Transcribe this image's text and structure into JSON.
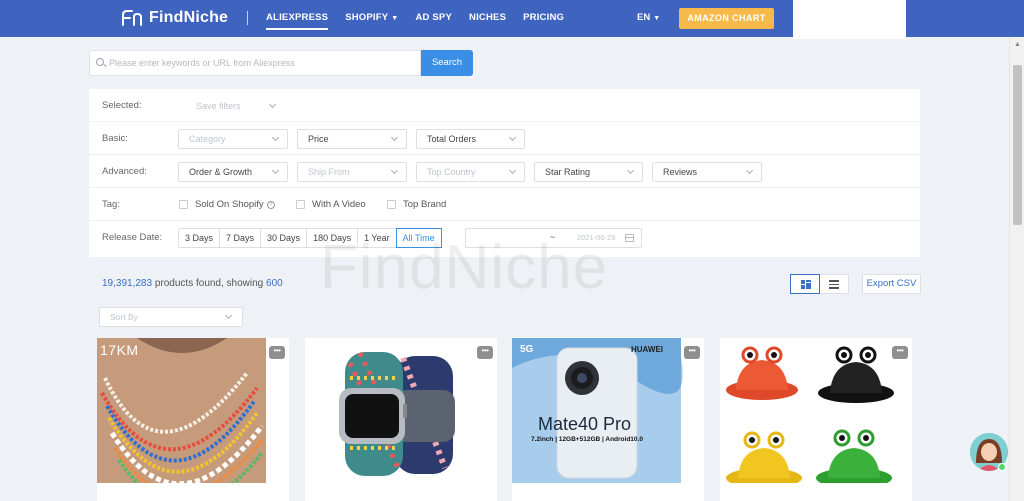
{
  "header": {
    "logo_text": "FindNiche",
    "nav": [
      {
        "label": "ALIEXPRESS",
        "active": true
      },
      {
        "label": "SHOPIFY",
        "has_caret": true
      },
      {
        "label": "AD SPY"
      },
      {
        "label": "NICHES"
      },
      {
        "label": "PRICING"
      }
    ],
    "language": "EN",
    "amazon_chart_label": "AMAZON CHART",
    "colors": {
      "bar": "#3e64c0",
      "amazon_button": "#f7b94a"
    }
  },
  "search": {
    "placeholder": "Please enter keywords or URL from Aliexpress",
    "button_label": "Search",
    "icon": "search-icon"
  },
  "filters": {
    "selected": {
      "label": "Selected:",
      "save_filters": "Save filters"
    },
    "basic": {
      "label": "Basic:",
      "category": "Category",
      "price": "Price",
      "total_orders": "Total Orders"
    },
    "advanced": {
      "label": "Advanced:",
      "order_growth": "Order & Growth",
      "ship_from": "Ship From",
      "top_country": "Top Country",
      "star_rating": "Star Rating",
      "reviews": "Reviews"
    },
    "tag": {
      "label": "Tag:",
      "sold_on_shopify": "Sold On Shopify",
      "with_a_video": "With A Video",
      "top_brand": "Top Brand"
    },
    "release_date": {
      "label": "Release Date:",
      "options": [
        "3 Days",
        "7 Days",
        "30 Days",
        "180 Days",
        "1 Year",
        "All Time"
      ],
      "active": "All Time",
      "range_start": "",
      "range_separator": "~",
      "range_end": "2021-06-29"
    }
  },
  "watermark": "FindNiche",
  "results": {
    "count": "19,391,283",
    "found_text": " products found, showing ",
    "showing": "600",
    "export_label": "Export CSV",
    "sort_placeholder": "Sort By",
    "view": "grid"
  },
  "products": [
    {
      "overlay_text": "17KM",
      "more": "•••"
    },
    {
      "more": "•••"
    },
    {
      "badge": "5G",
      "brand": "HUAWEI",
      "model": "Mate40 Pro",
      "specs": "7.2inch | 12GB+512GB | Android10.0",
      "more": "•••"
    },
    {
      "more": "•••"
    }
  ]
}
